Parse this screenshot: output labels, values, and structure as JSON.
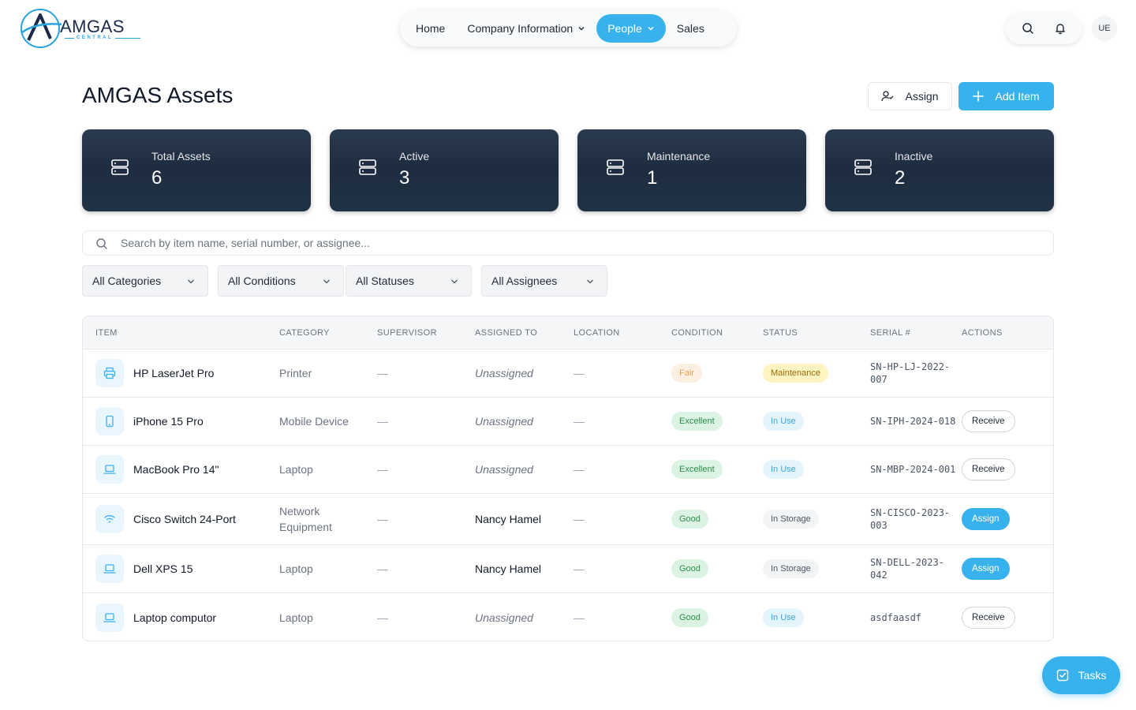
{
  "brand": {
    "name": "AMGAS",
    "sub": "CENTRAL",
    "mark_letter": "A"
  },
  "nav": {
    "items": [
      {
        "label": "Home",
        "has_menu": false,
        "active": false
      },
      {
        "label": "Company Information",
        "has_menu": true,
        "active": false
      },
      {
        "label": "People",
        "has_menu": true,
        "active": true
      },
      {
        "label": "Sales",
        "has_menu": false,
        "active": false
      }
    ]
  },
  "tools": {
    "search_icon": "search-icon",
    "bell_icon": "bell-icon"
  },
  "user": {
    "initials": "UE"
  },
  "page": {
    "title": "AMGAS Assets",
    "assign_label": "Assign",
    "add_label": "Add Item"
  },
  "stats": [
    {
      "label": "Total Assets",
      "value": "6"
    },
    {
      "label": "Active",
      "value": "3"
    },
    {
      "label": "Maintenance",
      "value": "1"
    },
    {
      "label": "Inactive",
      "value": "2"
    }
  ],
  "search": {
    "placeholder": "Search by item name, serial number, or assignee..."
  },
  "filters": [
    {
      "label": "All Categories"
    },
    {
      "label": "All Conditions"
    },
    {
      "label": "All Statuses"
    },
    {
      "label": "All Assignees"
    }
  ],
  "table": {
    "headers": [
      "Item",
      "Category",
      "Supervisor",
      "Assigned To",
      "Location",
      "Condition",
      "Status",
      "Serial #",
      "Actions"
    ],
    "rows": [
      {
        "icon": "printer-icon",
        "name": "HP LaserJet Pro",
        "category": "Printer",
        "supervisor": "—",
        "assigned": "Unassigned",
        "location": "—",
        "condition": "Fair",
        "status": "Maintenance",
        "serial": "SN-HP-LJ-2022-007",
        "action": ""
      },
      {
        "icon": "phone-icon",
        "name": "iPhone 15 Pro",
        "category": "Mobile Device",
        "supervisor": "—",
        "assigned": "Unassigned",
        "location": "—",
        "condition": "Excellent",
        "status": "In Use",
        "serial": "SN-IPH-2024-018",
        "action": "Receive"
      },
      {
        "icon": "laptop-icon",
        "name": "MacBook Pro 14\"",
        "category": "Laptop",
        "supervisor": "—",
        "assigned": "Unassigned",
        "location": "—",
        "condition": "Excellent",
        "status": "In Use",
        "serial": "SN-MBP-2024-001",
        "action": "Receive"
      },
      {
        "icon": "wifi-icon",
        "name": "Cisco Switch 24-Port",
        "category": "Network Equipment",
        "supervisor": "—",
        "assigned": "Nancy Hamel",
        "location": "—",
        "condition": "Good",
        "status": "In Storage",
        "serial": "SN-CISCO-2023-003",
        "action": "Assign"
      },
      {
        "icon": "laptop-icon",
        "name": "Dell XPS 15",
        "category": "Laptop",
        "supervisor": "—",
        "assigned": "Nancy Hamel",
        "location": "—",
        "condition": "Good",
        "status": "In Storage",
        "serial": "SN-DELL-2023-042",
        "action": "Assign"
      },
      {
        "icon": "laptop-icon",
        "name": "Laptop computor",
        "category": "Laptop",
        "supervisor": "—",
        "assigned": "Unassigned",
        "location": "—",
        "condition": "Good",
        "status": "In Use",
        "serial": "asdfaasdf",
        "action": "Receive"
      }
    ]
  },
  "tasks": {
    "label": "Tasks"
  },
  "colors": {
    "accent": "#38b2ec",
    "card": "#1e2d3f",
    "brand_navy": "#1b2a4a"
  }
}
